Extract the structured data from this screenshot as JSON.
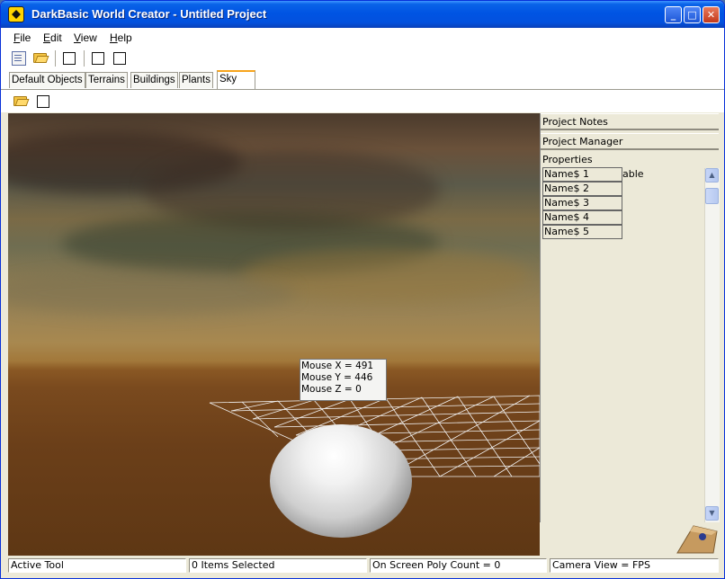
{
  "window": {
    "title": "DarkBasic World Creator - Untitled Project",
    "controls": {
      "minimize": "_",
      "maximize": "□",
      "close": "✕"
    }
  },
  "menu": [
    {
      "label": "File",
      "mnemonic": "F",
      "rest": "ile"
    },
    {
      "label": "Edit",
      "mnemonic": "E",
      "rest": "dit"
    },
    {
      "label": "View",
      "mnemonic": "V",
      "rest": "iew"
    },
    {
      "label": "Help",
      "mnemonic": "H",
      "rest": "elp"
    }
  ],
  "toolbar": {
    "icons": [
      "new-document-icon",
      "open-folder-icon",
      "blank-tool-icon",
      "blank-tool-icon",
      "blank-tool-icon"
    ]
  },
  "tabs": [
    {
      "label": "Default Objects",
      "active": false
    },
    {
      "label": "Terrains",
      "active": false
    },
    {
      "label": "Buildings",
      "active": false
    },
    {
      "label": "Plants",
      "active": false
    },
    {
      "label": "Sky",
      "active": true
    }
  ],
  "subtoolbar": {
    "icons": [
      "open-folder-icon",
      "blank-tool-icon"
    ]
  },
  "viewport": {
    "mouse": {
      "x_line": "Mouse X = 491",
      "y_line": "Mouse Y = 446",
      "z_line": "Mouse Z = 0"
    }
  },
  "side_panel": {
    "project_notes": "Project Notes",
    "project_manager": "Project Manager",
    "properties": "Properties",
    "able_text": "able",
    "names": [
      "Name$ 1",
      "Name$ 2",
      "Name$ 3",
      "Name$ 4",
      "Name$ 5"
    ],
    "scroll_up": "▲",
    "scroll_down": "▼"
  },
  "statusbar": {
    "active_tool": "Active Tool",
    "items_selected": "0 Items Selected",
    "poly_count": "On Screen Poly Count = 0",
    "camera_view": "Camera View = FPS"
  },
  "colors": {
    "titlebar": "#0054e3",
    "window_bg": "#ece9d8",
    "active_tab_accent": "#f7a41c"
  }
}
